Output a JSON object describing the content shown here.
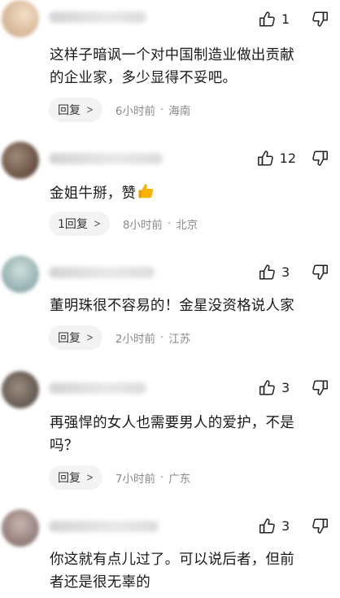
{
  "comments": [
    {
      "likes": "1",
      "text_lines": [
        "这样子暗讽一个对中国制造业做出贡献",
        "的企业家，多少显得不妥吧。"
      ],
      "reply_label": "回复",
      "time": "6小时前",
      "separator": "·",
      "location": "海南"
    },
    {
      "likes": "12",
      "text_lines": [
        "金姐牛掰，赞"
      ],
      "emoji": "thumbs-up-emoji",
      "reply_label": "1回复",
      "time": "8小时前",
      "separator": "·",
      "location": "北京"
    },
    {
      "likes": "3",
      "text_lines": [
        "董明珠很不容易的！金星没资格说人家"
      ],
      "reply_label": "回复",
      "time": "2小时前",
      "separator": "·",
      "location": "江苏"
    },
    {
      "likes": "3",
      "text_lines": [
        "再强悍的女人也需要男人的爱护，不是",
        "吗？"
      ],
      "reply_label": "回复",
      "time": "7小时前",
      "separator": "·",
      "location": "广东"
    },
    {
      "likes": "3",
      "text_lines": [
        "你这就有点儿过了。可以说后者，但前",
        "者还是很无辜的"
      ]
    }
  ],
  "icons": {
    "like": "thumbs-up-outline-icon",
    "dislike": "thumbs-down-outline-icon",
    "chevron": "chevron-right-icon"
  },
  "colors": {
    "reply_bg": "#f3f3f3",
    "meta_text": "#8a8a8a",
    "emoji": "#f5b400"
  }
}
